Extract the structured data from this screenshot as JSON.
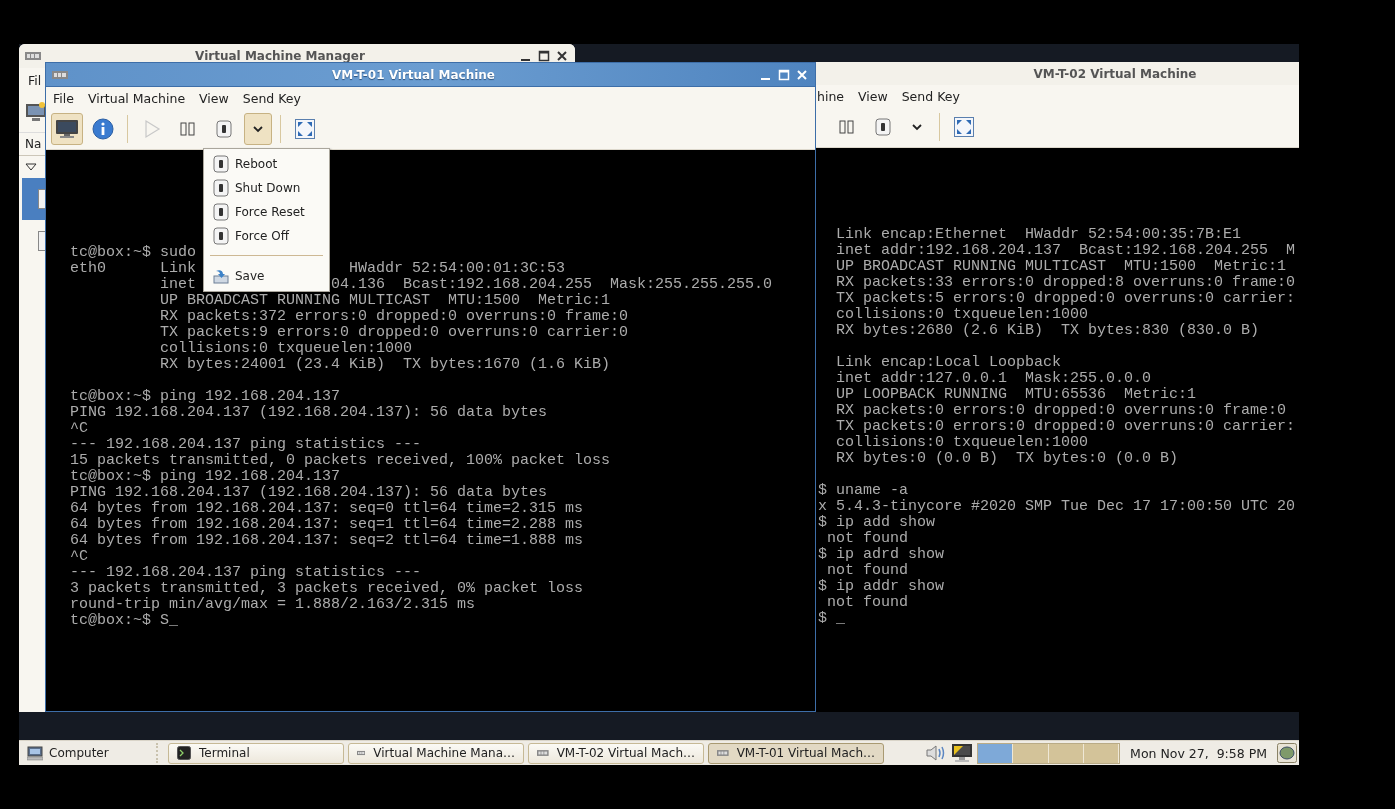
{
  "desktop": {
    "windows": [
      {
        "title": "Virtual Machine Manager",
        "active": false,
        "menu": [
          "Fil"
        ],
        "column_header": "Na",
        "tree": {
          "expanded": true,
          "rows": [
            {
              "selected": true
            },
            {
              "selected": false
            }
          ]
        }
      },
      {
        "title": "VM-T-01 Virtual Machine",
        "active": true,
        "menu": [
          "File",
          "Virtual Machine",
          "View",
          "Send Key"
        ],
        "toolbar": [
          {
            "kind": "console",
            "selected": true
          },
          {
            "kind": "info",
            "selected": false
          },
          {
            "kind": "separator"
          },
          {
            "kind": "play",
            "disabled": true
          },
          {
            "kind": "pause",
            "disabled": false
          },
          {
            "kind": "power"
          },
          {
            "kind": "dropdown",
            "selected": true
          },
          {
            "kind": "separator"
          },
          {
            "kind": "fullscreen"
          }
        ],
        "terminal": {
          "blocks": [
            [
              [
                "tc@box:~$ sudo"
              ],
              [
                "eth0      Link",
                "  HWaddr 52:54:00:01:3C:53"
              ],
              [
                "          inet",
                "04.136  Bcast:192.168.204.255  Mask:255.255.255.0"
              ],
              "          UP BROADCAST RUNNING MULTICAST  MTU:1500  Metric:1",
              "          RX packets:372 errors:0 dropped:0 overruns:0 frame:0",
              "          TX packets:9 errors:0 dropped:0 overruns:0 carrier:0",
              "          collisions:0 txqueuelen:1000",
              "          RX bytes:24001 (23.4 KiB)  TX bytes:1670 (1.6 KiB)"
            ],
            [
              "tc@box:~$ ping 192.168.204.137",
              "PING 192.168.204.137 (192.168.204.137): 56 data bytes",
              "^C",
              "--- 192.168.204.137 ping statistics ---",
              "15 packets transmitted, 0 packets received, 100% packet loss",
              "tc@box:~$ ping 192.168.204.137",
              "PING 192.168.204.137 (192.168.204.137): 56 data bytes",
              "64 bytes from 192.168.204.137: seq=0 ttl=64 time=2.315 ms",
              "64 bytes from 192.168.204.137: seq=1 ttl=64 time=2.288 ms",
              "64 bytes from 192.168.204.137: seq=2 ttl=64 time=1.888 ms",
              "^C",
              "--- 192.168.204.137 ping statistics ---",
              "3 packets transmitted, 3 packets received, 0% packet loss",
              "round-trip min/avg/max = 1.888/2.163/2.315 ms",
              "tc@box:~$ S_"
            ]
          ]
        }
      },
      {
        "title": "VM-T-02 Virtual Machine",
        "active": false,
        "menu": [
          "hine",
          "View",
          "Send Key"
        ],
        "toolbar": [
          {
            "kind": "pause",
            "disabled": false
          },
          {
            "kind": "power"
          },
          {
            "kind": "dropdown",
            "selected": false
          },
          {
            "kind": "separator"
          },
          {
            "kind": "fullscreen"
          }
        ],
        "terminal": {
          "blocks": [
            [
              "  Link encap:Ethernet  HWaddr 52:54:00:35:7B:E1",
              "  inet addr:192.168.204.137  Bcast:192.168.204.255  M",
              "  UP BROADCAST RUNNING MULTICAST  MTU:1500  Metric:1",
              "  RX packets:33 errors:0 dropped:8 overruns:0 frame:0",
              "  TX packets:5 errors:0 dropped:0 overruns:0 carrier:",
              "  collisions:0 txqueuelen:1000",
              "  RX bytes:2680 (2.6 KiB)  TX bytes:830 (830.0 B)"
            ],
            [
              "  Link encap:Local Loopback",
              "  inet addr:127.0.0.1  Mask:255.0.0.0",
              "  UP LOOPBACK RUNNING  MTU:65536  Metric:1",
              "  RX packets:0 errors:0 dropped:0 overruns:0 frame:0",
              "  TX packets:0 errors:0 dropped:0 overruns:0 carrier:",
              "  collisions:0 txqueuelen:1000",
              "  RX bytes:0 (0.0 B)  TX bytes:0 (0.0 B)"
            ],
            [
              "$ uname -a",
              "x 5.4.3-tinycore #2020 SMP Tue Dec 17 17:00:50 UTC 20",
              "$ ip add show",
              " not found",
              "$ ip adrd show",
              " not found",
              "$ ip addr show",
              " not found",
              "$ _"
            ]
          ]
        }
      }
    ],
    "dropdown_menu": {
      "items": [
        {
          "kind": "item",
          "label": "Reboot"
        },
        {
          "kind": "item",
          "label": "Shut Down"
        },
        {
          "kind": "item",
          "label": "Force Reset"
        },
        {
          "kind": "item",
          "label": "Force Off"
        },
        {
          "kind": "separator"
        },
        {
          "kind": "save",
          "label": "Save"
        }
      ]
    }
  },
  "taskbar": {
    "launcher": "Computer",
    "tasks": [
      {
        "kind": "terminal",
        "label": "Terminal",
        "selected": false
      },
      {
        "kind": "vm",
        "label": "Virtual Machine Mana…",
        "selected": false
      },
      {
        "kind": "vm",
        "label": "VM-T-02 Virtual Mach…",
        "selected": false
      },
      {
        "kind": "vm",
        "label": "VM-T-01 Virtual Mach…",
        "selected": true
      }
    ],
    "workspaces": [
      {
        "selected": true
      },
      {
        "selected": false
      },
      {
        "selected": false
      },
      {
        "selected": false
      }
    ],
    "clock": "Mon Nov 27,  9:58 PM"
  }
}
